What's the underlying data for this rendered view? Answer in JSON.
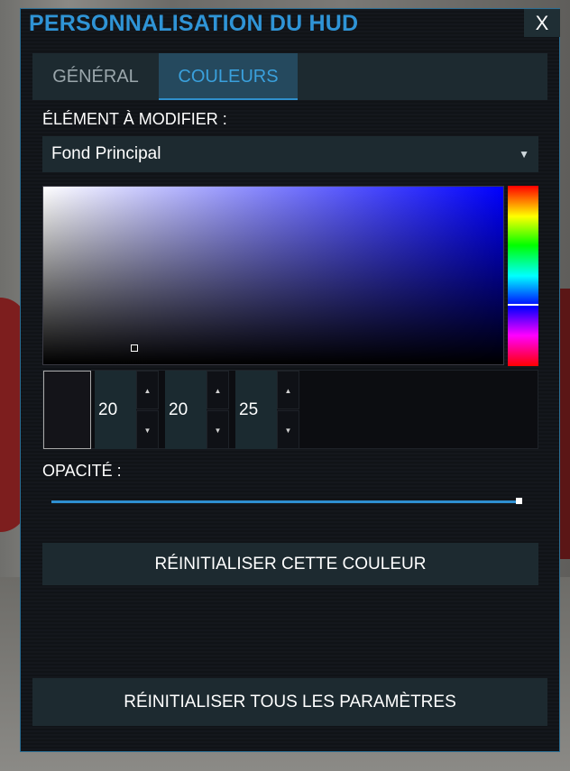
{
  "window": {
    "title": "PERSONNALISATION DU HUD",
    "close_label": "X"
  },
  "tabs": [
    {
      "label": "GÉNÉRAL",
      "active": false
    },
    {
      "label": "COULEURS",
      "active": true
    }
  ],
  "element": {
    "label": "ÉLÉMENT À MODIFIER :",
    "selected": "Fond Principal"
  },
  "color": {
    "current_hex": "#141419",
    "r": "20",
    "g": "20",
    "b": "25"
  },
  "opacity": {
    "label": "OPACITÉ :",
    "value": 1.0
  },
  "buttons": {
    "reset_color": "RÉINITIALISER CETTE COULEUR",
    "reset_all": "RÉINITIALISER TOUS LES PARAMÈTRES"
  },
  "icons": {
    "dropdown": "chevron-down-icon",
    "spin_up": "triangle-up-icon",
    "spin_down": "triangle-down-icon"
  },
  "colors": {
    "accent": "#2f94d6",
    "panel": "#1d2a30",
    "tab_active": "#25495e"
  }
}
